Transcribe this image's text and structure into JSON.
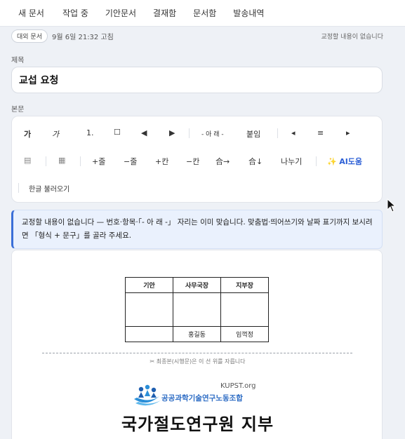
{
  "topnav": {
    "tabs": [
      "새 문서",
      "작업 중",
      "기안문서",
      "결재함",
      "문서함",
      "발송내역"
    ]
  },
  "meta": {
    "badge": "대외 문서",
    "date": "9월 6일 21:32 고침",
    "status": "교정할 내용이 없습니다"
  },
  "title_field": {
    "label": "제목",
    "value": "교섭 요청"
  },
  "body_field": {
    "label": "본문"
  },
  "toolbar": {
    "bold": "가",
    "italic": "가",
    "numbered": "1.",
    "checkbox": "☐",
    "prev": "◀",
    "next": "▶",
    "below": "- 아 래 -",
    "attach": "붙임",
    "align_left": "◂",
    "align_center": "≡",
    "align_right": "▸",
    "table_small": "▤",
    "table_grid": "▦",
    "add_row": "+줄",
    "del_row": "−줄",
    "add_col": "+칸",
    "del_col": "−칸",
    "merge_right": "合→",
    "merge_down": "合↓",
    "split": "나누기",
    "ai_star": "✨",
    "ai": "AI도움",
    "import_hwp": "한글 불러오기"
  },
  "notice": {
    "text": "교정할 내용이 없습니다 — 번호·항목·「- 아 래 -」 자리는 이미 맞습니다. 맞춤법·띄어쓰기와 날짜 표기까지 보시려면 「형식 + 문구」를 골라 주세요."
  },
  "document": {
    "approval": {
      "headers": [
        "기안",
        "사무국장",
        "지부장"
      ],
      "names": [
        "",
        "홍길동",
        "임꺽정"
      ]
    },
    "cut_note": "✂ 최종본(시행문)은 이 선 위를 자릅니다",
    "org_en": "KUPST.org",
    "org_kr": "공공과학기술연구노동조합",
    "title": "국가절도연구원 지부"
  }
}
